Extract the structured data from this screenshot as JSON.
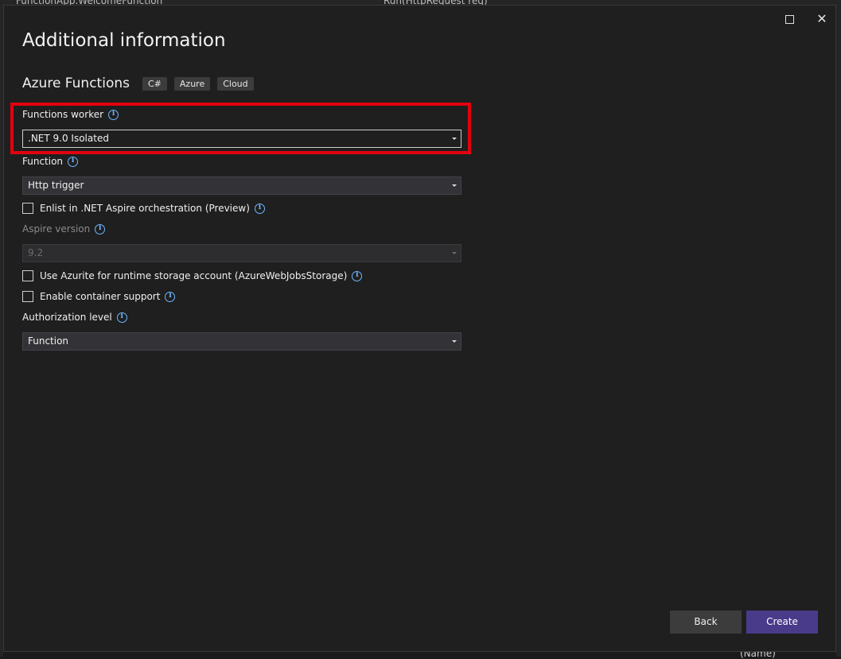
{
  "ide": {
    "tab_left": "FunctionApp.WelcomeFunction",
    "tab_right": "Run(HttpRequest req)",
    "bottom_fragment": "(Name)"
  },
  "dialog": {
    "title": "Additional information",
    "project_name": "Azure Functions",
    "tags": [
      "C#",
      "Azure",
      "Cloud"
    ]
  },
  "fields": {
    "functions_worker": {
      "label": "Functions worker",
      "value": ".NET 9.0 Isolated"
    },
    "function": {
      "label": "Function",
      "value": "Http trigger"
    },
    "aspire_enlist": {
      "label": "Enlist in .NET Aspire orchestration (Preview)",
      "checked": false
    },
    "aspire_version": {
      "label": "Aspire version",
      "value": "9.2",
      "disabled": true
    },
    "azurite": {
      "label": "Use Azurite for runtime storage account (AzureWebJobsStorage)",
      "checked": false
    },
    "container": {
      "label": "Enable container support",
      "checked": false
    },
    "authorization": {
      "label": "Authorization level",
      "value": "Function"
    }
  },
  "buttons": {
    "back": "Back",
    "create": "Create"
  },
  "colors": {
    "highlight": "#e3000f",
    "create_button": "#4a3a8a",
    "info_icon": "#6fb6ff"
  }
}
